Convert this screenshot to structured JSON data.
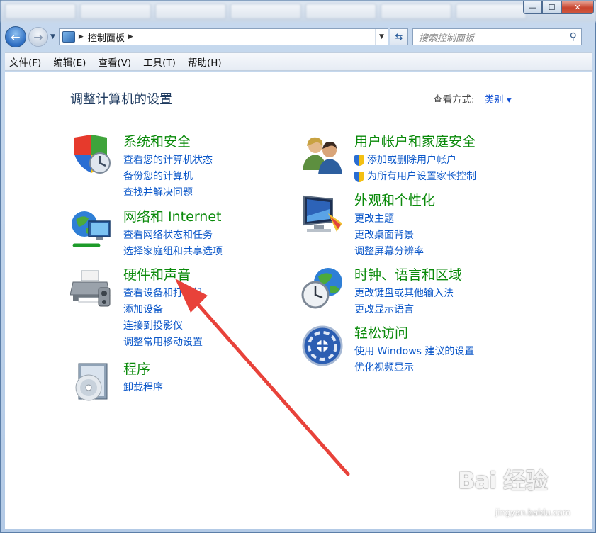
{
  "window": {
    "caption_min": "—",
    "caption_max": "☐",
    "caption_close": "✕"
  },
  "nav": {
    "back_glyph": "←",
    "forward_glyph": "→",
    "address_crumb": "控制面板",
    "search_placeholder": "搜索控制面板",
    "search_icon": "search-icon"
  },
  "menu": [
    "文件(F)",
    "编辑(E)",
    "查看(V)",
    "工具(T)",
    "帮助(H)"
  ],
  "main": {
    "title": "调整计算机的设置",
    "view_by_label": "查看方式:",
    "view_by_value": "类别 ▾"
  },
  "categories_left": [
    {
      "title": "系统和安全",
      "icon": "shield-security-icon",
      "links": [
        "查看您的计算机状态",
        "备份您的计算机",
        "查找并解决问题"
      ]
    },
    {
      "title": "网络和 Internet",
      "icon": "network-globe-icon",
      "links": [
        "查看网络状态和任务",
        "选择家庭组和共享选项"
      ]
    },
    {
      "title": "硬件和声音",
      "icon": "printer-icon",
      "links": [
        "查看设备和打印机",
        "添加设备",
        "连接到投影仪",
        "调整常用移动设置"
      ]
    },
    {
      "title": "程序",
      "icon": "programs-disc-icon",
      "links": [
        "卸载程序"
      ]
    }
  ],
  "categories_right": [
    {
      "title": "用户帐户和家庭安全",
      "icon": "users-icon",
      "links": [
        "添加或删除用户帐户",
        "为所有用户设置家长控制"
      ]
    },
    {
      "title": "外观和个性化",
      "icon": "monitor-palette-icon",
      "links": [
        "更改主题",
        "更改桌面背景",
        "调整屏幕分辨率"
      ]
    },
    {
      "title": "时钟、语言和区域",
      "icon": "clock-globe-icon",
      "links": [
        "更改键盘或其他输入法",
        "更改显示语言"
      ]
    },
    {
      "title": "轻松访问",
      "icon": "ease-of-access-icon",
      "links": [
        "使用 Windows 建议的设置",
        "优化视频显示"
      ]
    }
  ],
  "watermark": {
    "logo": "Bai 经验",
    "url": "jingyan.baidu.com"
  },
  "colors": {
    "category_title": "#0a8a0a",
    "link": "#0b57c9",
    "arrow": "#e8423a"
  }
}
